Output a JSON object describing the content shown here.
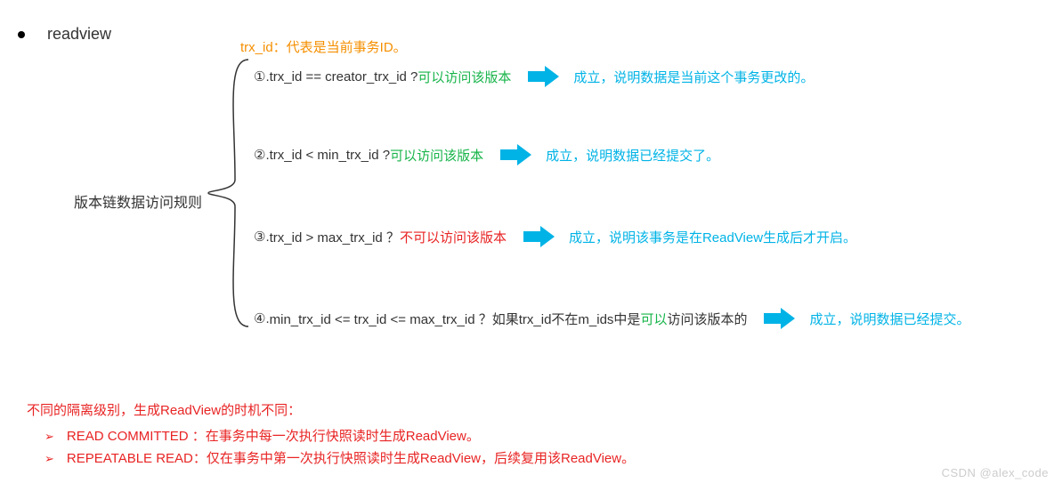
{
  "header": {
    "title": "readview"
  },
  "trx_note": "trx_id：代表是当前事务ID。",
  "left_label": "版本链数据访问规则",
  "rules": [
    {
      "num": "①.",
      "cond_prefix": " trx_id  == creator_trx_id ? ",
      "result": "可以访问该版本",
      "result_color": "green",
      "explain": "成立，说明数据是当前这个事务更改的。"
    },
    {
      "num": "②.",
      "cond_prefix": " trx_id < min_trx_id ? ",
      "result": "可以访问该版本",
      "result_color": "green",
      "explain": "成立，说明数据已经提交了。"
    },
    {
      "num": "③.",
      "cond_prefix": " trx_id > max_trx_id ？",
      "result": "不可以访问该版本",
      "result_color": "red",
      "explain": "成立，说明该事务是在ReadView生成后才开启。"
    },
    {
      "num": "④.",
      "cond_prefix": " min_trx_id <= trx_id <= max_trx_id ？如果trx_id不在m_ids中是",
      "result": "可以",
      "result_color": "green",
      "cond_suffix": "访问该版本的",
      "explain": "成立，说明数据已经提交。"
    }
  ],
  "bottom": {
    "title": "不同的隔离级别，生成ReadView的时机不同：",
    "items": [
      "READ COMMITTED ：在事务中每一次执行快照读时生成ReadView。",
      "REPEATABLE READ：仅在事务中第一次执行快照读时生成ReadView，后续复用该ReadView。"
    ]
  },
  "watermark": "CSDN @alex_code",
  "colors": {
    "arrow_fill": "#00b3e6",
    "green": "#17b44a",
    "red": "#e82424",
    "orange": "#f58f00"
  }
}
